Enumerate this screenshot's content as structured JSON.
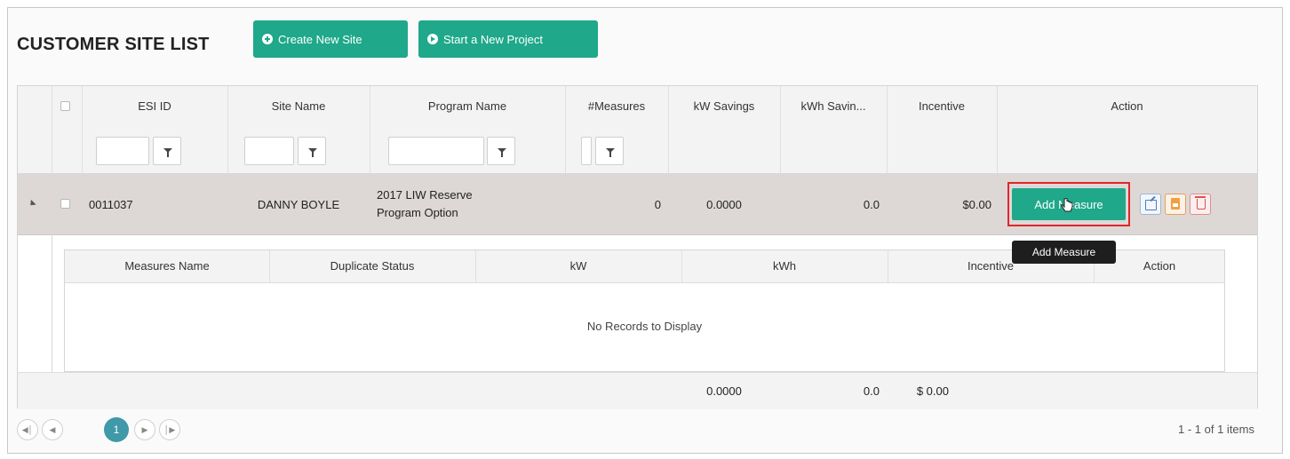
{
  "page": {
    "title": "CUSTOMER SITE LIST"
  },
  "toolbar": {
    "create_site_label": "Create New Site",
    "start_project_label": "Start a New Project"
  },
  "grid": {
    "columns": [
      "ESI ID",
      "Site Name",
      "Program Name",
      "#Measures",
      "kW Savings",
      "kWh Savin...",
      "Incentive",
      "Action"
    ],
    "row": {
      "esi_id": "0011037",
      "site_name": "DANNY BOYLE",
      "program_line1": "2017 LIW Reserve",
      "program_line2": "Program Option",
      "measures": "0",
      "kw_savings": "0.0000",
      "kwh_savings": "0.0",
      "incentive": "$0.00",
      "add_measure_label": "Add Measure"
    },
    "tooltip": "Add Measure",
    "detail": {
      "columns": [
        "Measures Name",
        "Duplicate Status",
        "kW",
        "kWh",
        "Incentive",
        "Action"
      ],
      "empty_text": "No Records to Display"
    },
    "totals": {
      "kw": "0.0000",
      "kwh": "0.0",
      "incentive": "$ 0.00"
    }
  },
  "pager": {
    "current_page": "1",
    "info": "1 - 1 of 1 items"
  },
  "colors": {
    "accent": "#1fa88a",
    "row_selected": "#ddd8d6",
    "highlight_box": "#e0262b",
    "pager_active": "#3f99a8"
  }
}
